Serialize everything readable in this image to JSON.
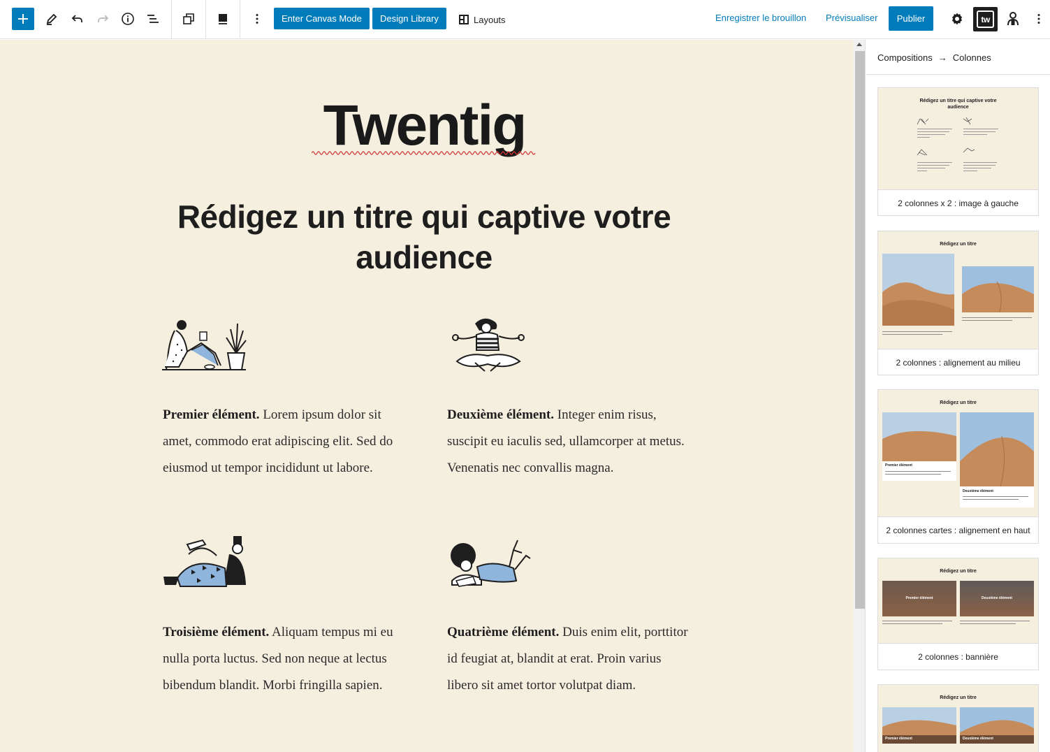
{
  "toolbar": {
    "enter_canvas_label": "Enter Canvas Mode",
    "design_library_label": "Design Library",
    "layouts_label": "Layouts",
    "save_draft_label": "Enregistrer le brouillon",
    "preview_label": "Prévisualiser",
    "publish_label": "Publier",
    "twentig_badge": "tw",
    "accent_color": "#007cba",
    "icons": [
      "plus-icon",
      "pencil-icon",
      "undo-icon",
      "redo-icon",
      "info-icon",
      "list-view-icon",
      "duplicate-icon",
      "block-align-icon",
      "more-vertical-icon",
      "layouts-icon",
      "gear-icon",
      "user-icon"
    ]
  },
  "canvas": {
    "background": "#f5efe0",
    "site_title": "Twentig",
    "heading_line1": "Rédigez un titre qui captive votre",
    "heading_line2": "audience",
    "items": [
      {
        "title": "Premier élément.",
        "text": " Lorem ipsum dolor sit amet, commodo erat adipiscing elit. Sed do eiusmod ut tempor incididunt ut labore."
      },
      {
        "title": "Deuxième élément.",
        "text": " Integer enim risus, suscipit eu iaculis sed, ullamcorper at metus. Venenatis nec convallis magna."
      },
      {
        "title": "Troisième élément.",
        "text": " Aliquam tempus mi eu nulla porta luctus. Sed non neque at lectus bibendum blandit. Morbi fringilla sapien."
      },
      {
        "title": "Quatrième élément.",
        "text": " Duis enim elit, porttitor id feugiat at, blandit at erat. Proin varius libero sit amet tortor volutpat diam."
      }
    ]
  },
  "sidebar": {
    "breadcrumb_root": "Compositions",
    "breadcrumb_arrow": "→",
    "breadcrumb_current": "Colonnes",
    "patterns": [
      {
        "label": "2 colonnes x 2 : image à gauche",
        "preview_title": "Rédigez un titre qui captive votre audience"
      },
      {
        "label": "2 colonnes : alignement au milieu",
        "preview_title": "Rédigez un titre"
      },
      {
        "label": "2 colonnes cartes : alignement en haut",
        "preview_title": "Rédigez un titre",
        "card1": "Premier élément",
        "card2": "Deuxième élément"
      },
      {
        "label": "2 colonnes : bannière",
        "preview_title": "Rédigez un titre",
        "card1": "Premier élément",
        "card2": "Deuxième élément"
      },
      {
        "label": "",
        "preview_title": "Rédigez un titre",
        "card1": "Premier élément",
        "card2": "Deuxième élément"
      }
    ]
  }
}
